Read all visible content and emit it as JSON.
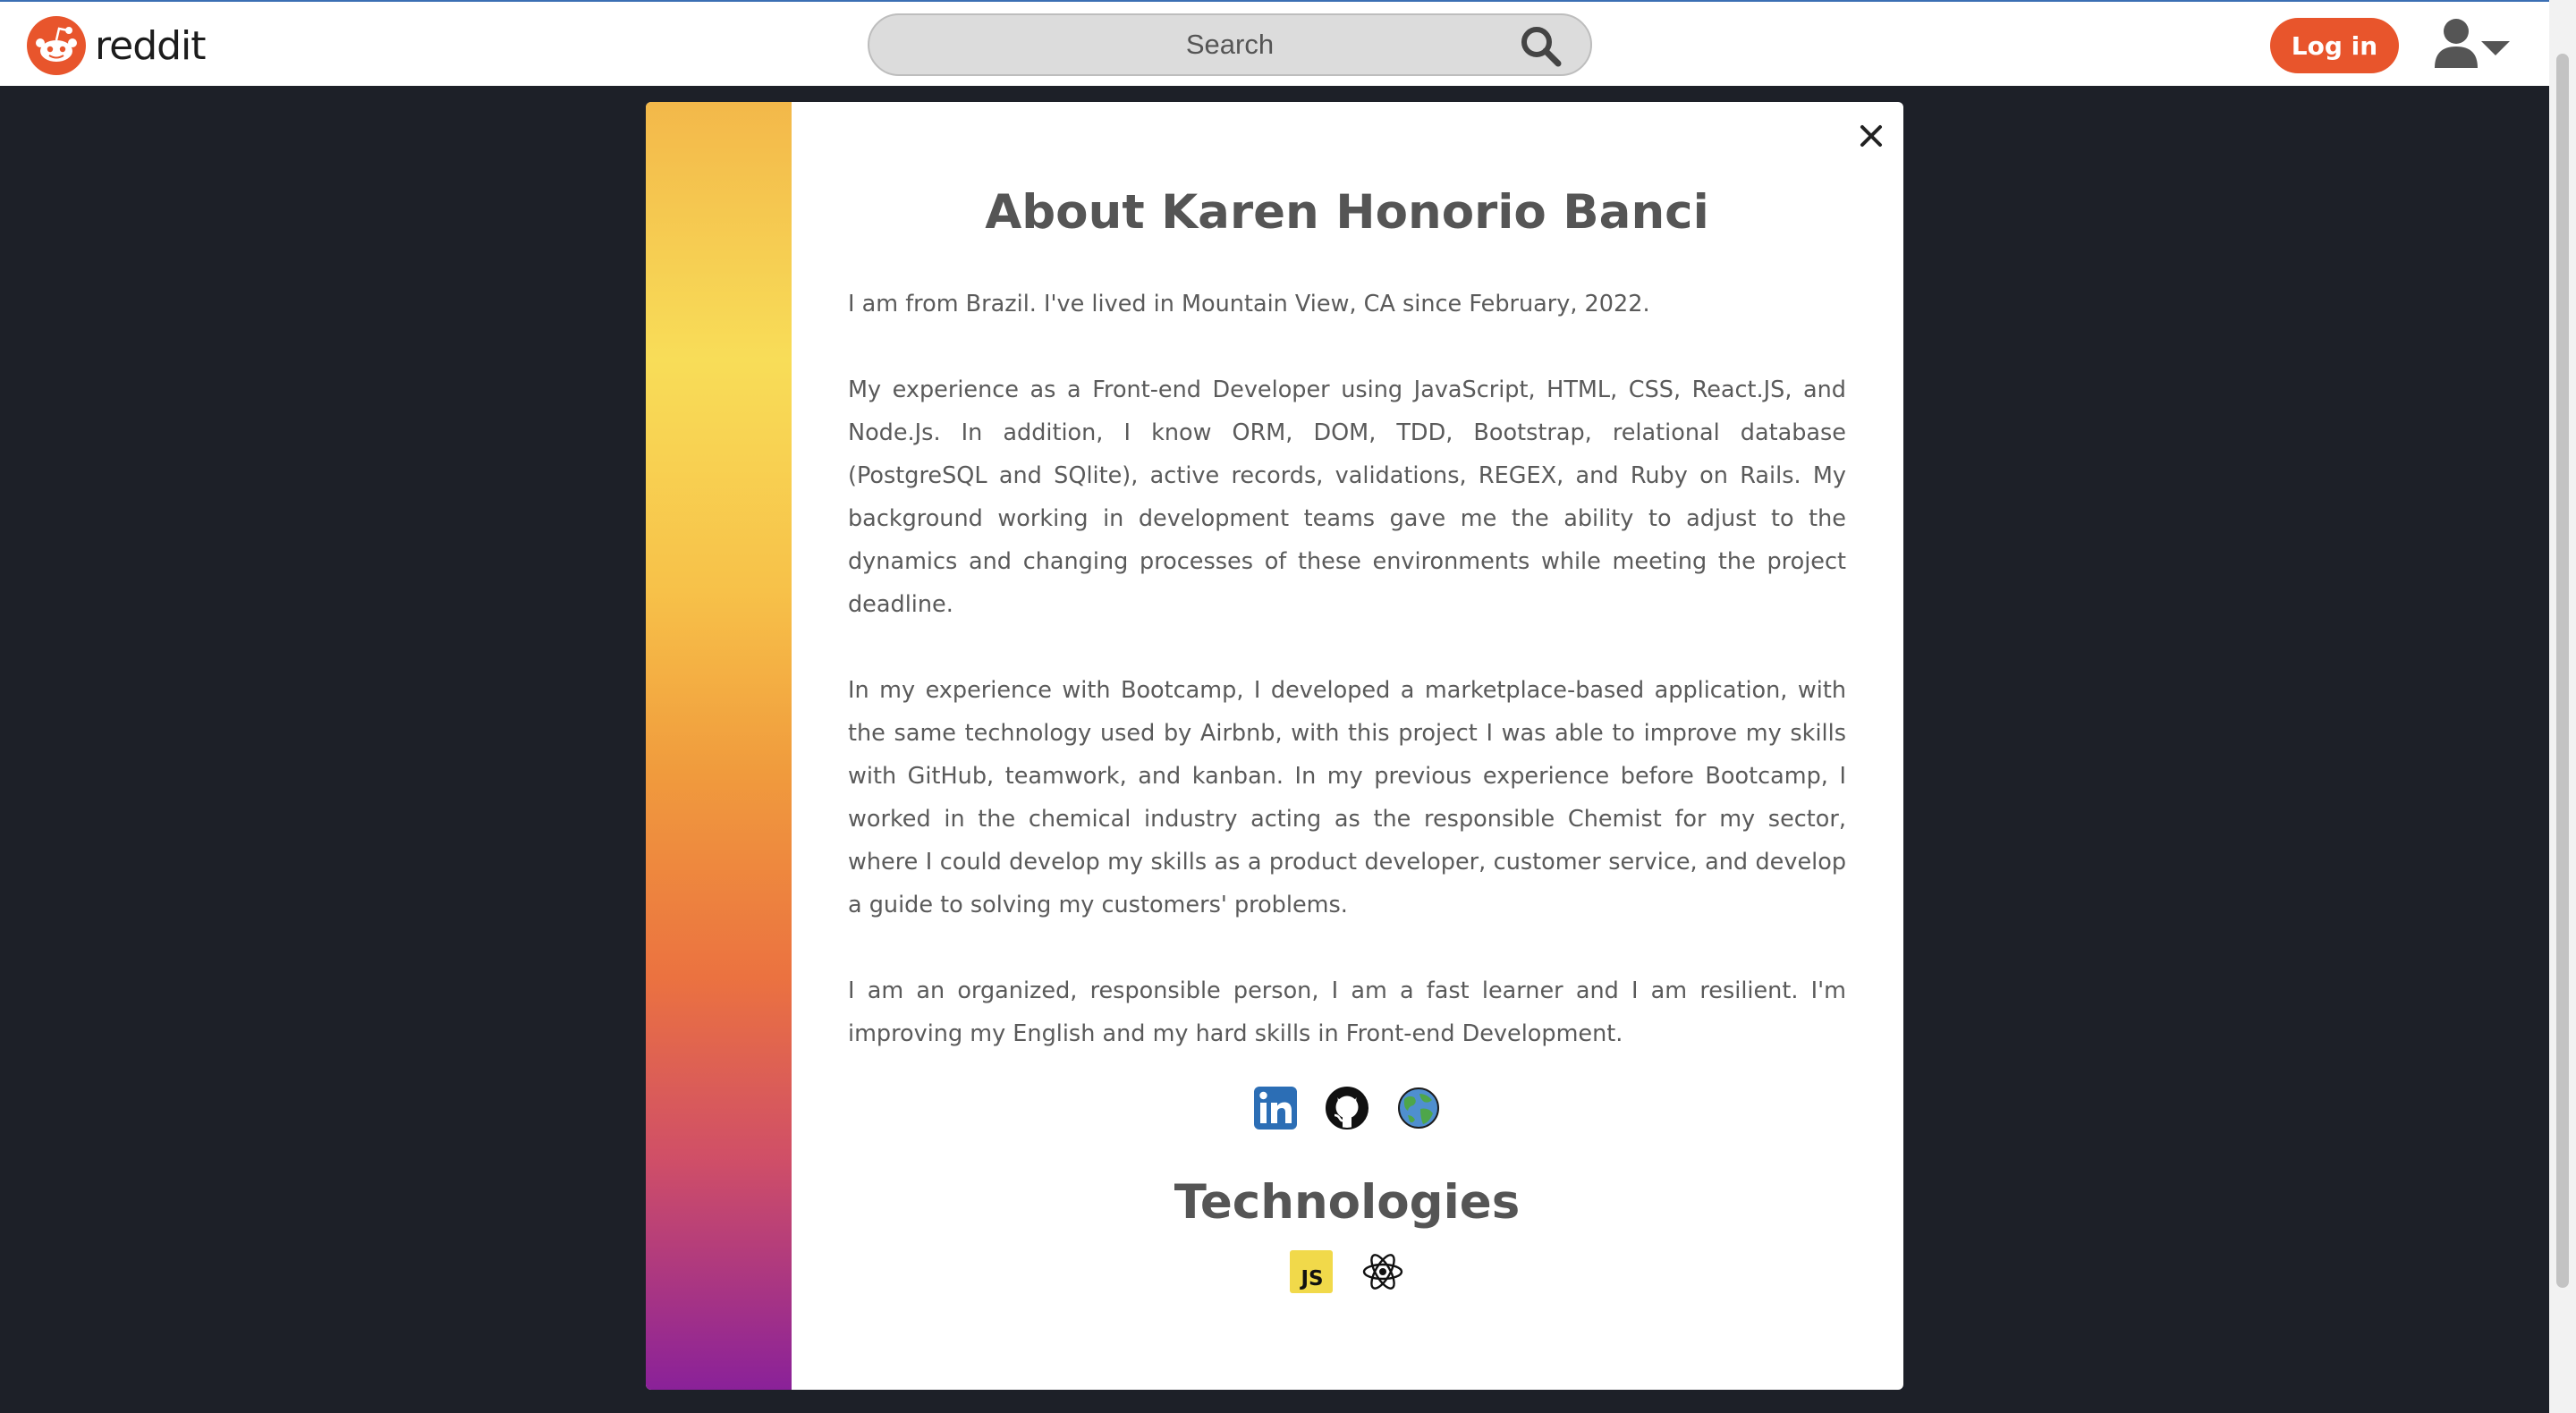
{
  "header": {
    "brand": "reddit",
    "search_placeholder": "Search",
    "login_label": "Log in",
    "logo_icon": "reddit-logo-icon",
    "user_icon": "user-menu-icon"
  },
  "colors": {
    "accent": "#e8552c",
    "page_bg": "#1d2028",
    "heading": "#555555",
    "body_text": "#5a5a5a"
  },
  "modal": {
    "title": "About Karen Honorio Banci",
    "paragraphs": [
      "I am from Brazil. I've lived in Mountain View, CA since February, 2022.",
      "My experience as a Front-end Developer using JavaScript, HTML, CSS, React.JS, and Node.Js. In addition, I know ORM, DOM, TDD, Bootstrap, relational database (PostgreSQL and SQlite), active records, validations, REGEX, and Ruby on Rails. My background working in development teams gave me the ability to adjust to the dynamics and changing processes of these environments while meeting the project deadline.",
      "In my experience with Bootcamp, I developed a marketplace-based application, with the same technology used by Airbnb, with this project I was able to improve my skills with GitHub, teamwork, and kanban. In my previous experience before Bootcamp, I worked in the chemical industry acting as the responsible Chemist for my sector, where I could develop my skills as a product developer, customer service, and develop a guide to solving my customers' problems.",
      "I am an organized, responsible person, I am a fast learner and I am resilient. I'm improving my English and my hard skills in Front-end Development."
    ],
    "social_icons": [
      "linkedin-icon",
      "github-icon",
      "globe-icon"
    ],
    "technologies_title": "Technologies",
    "technology_icons": [
      "javascript-icon",
      "react-icon"
    ],
    "js_badge": "JS",
    "close_icon": "close-icon"
  }
}
